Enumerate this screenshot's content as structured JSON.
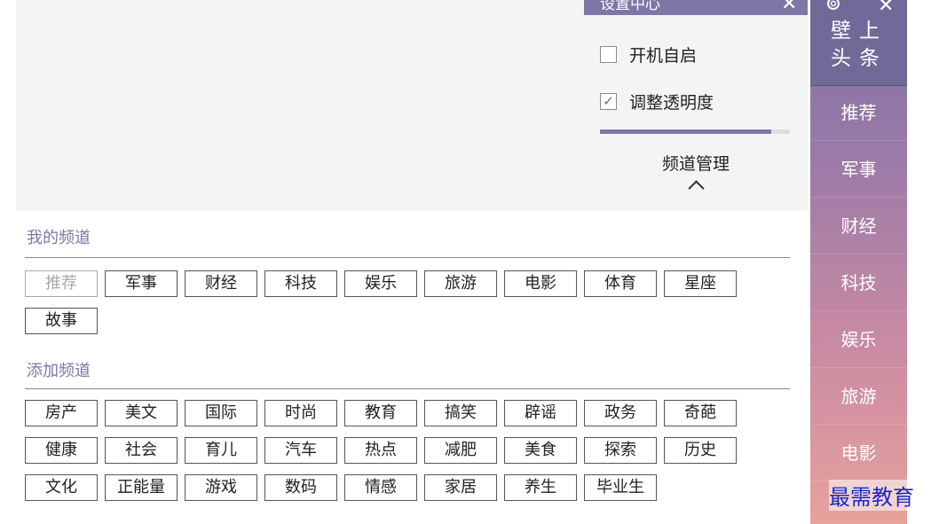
{
  "settings": {
    "title": "设置中心",
    "close": "✕",
    "auto_start_label": "开机自启",
    "auto_start_checked": false,
    "transparency_label": "调整透明度",
    "transparency_checked": true,
    "transparency_level": 0.9,
    "channel_management": "频道管理"
  },
  "sidebar": {
    "logo": "壁上头条",
    "close": "✕",
    "items": [
      "推荐",
      "军事",
      "财经",
      "科技",
      "娱乐",
      "旅游",
      "电影"
    ]
  },
  "my_channels": {
    "title": "我的频道",
    "tags": [
      "推荐",
      "军事",
      "财经",
      "科技",
      "娱乐",
      "旅游",
      "电影",
      "体育",
      "星座",
      "故事"
    ]
  },
  "add_channels": {
    "title": "添加频道",
    "tags": [
      "房产",
      "美文",
      "国际",
      "时尚",
      "教育",
      "搞笑",
      "辟谣",
      "政务",
      "奇葩",
      "健康",
      "社会",
      "育儿",
      "汽车",
      "热点",
      "减肥",
      "美食",
      "探索",
      "历史",
      "文化",
      "正能量",
      "游戏",
      "数码",
      "情感",
      "家居",
      "养生",
      "毕业生"
    ]
  },
  "watermark": "最需教育",
  "colors": {
    "accent": "#7e76a6",
    "sidebar_top": "#6f6a98"
  }
}
